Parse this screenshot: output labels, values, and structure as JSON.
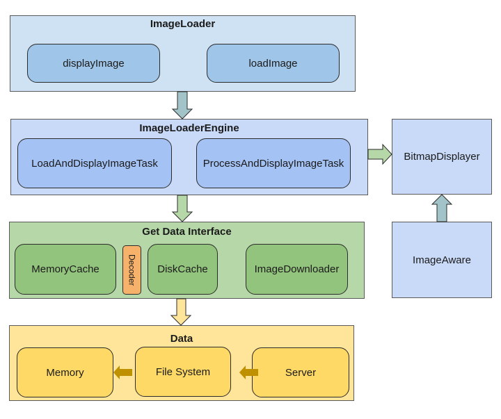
{
  "diagram": {
    "groups": {
      "image_loader": {
        "title": "ImageLoader",
        "nodes": [
          "displayImage",
          "loadImage"
        ],
        "color": "#cfe2f3",
        "node_color": "#9fc5e8"
      },
      "image_loader_engine": {
        "title": "ImageLoaderEngine",
        "nodes": [
          "LoadAndDisplayImageTask",
          "ProcessAndDisplayImageTask"
        ],
        "color": "#c9daf8",
        "node_color": "#a4c2f4"
      },
      "get_data_interface": {
        "title": "Get Data Interface",
        "nodes": [
          "MemoryCache",
          "Decoder",
          "DiskCache",
          "ImageDownloader"
        ],
        "color": "#b6d7a8",
        "node_color": "#93c47d",
        "decoder_color": "#f6b26b"
      },
      "data": {
        "title": "Data",
        "nodes": [
          "Memory",
          "File System",
          "Server"
        ],
        "color": "#ffe599",
        "node_color": "#ffd966"
      }
    },
    "side_nodes": {
      "bitmap_displayer": "BitmapDisplayer",
      "image_aware": "ImageAware"
    },
    "edges": [
      {
        "from": "ImageLoader",
        "to": "ImageLoaderEngine",
        "color": "#a2c4c9"
      },
      {
        "from": "ImageLoaderEngine",
        "to": "BitmapDisplayer",
        "color": "#b6d7a8"
      },
      {
        "from": "ImageAware",
        "to": "BitmapDisplayer",
        "color": "#a2c4c9"
      },
      {
        "from": "ImageLoaderEngine",
        "to": "Get Data Interface",
        "color": "#b6d7a8"
      },
      {
        "from": "Get Data Interface",
        "to": "Data",
        "color": "#ffe599"
      },
      {
        "from": "Server",
        "to": "File System",
        "color": "#bf9000"
      },
      {
        "from": "File System",
        "to": "Memory",
        "color": "#bf9000"
      }
    ]
  }
}
